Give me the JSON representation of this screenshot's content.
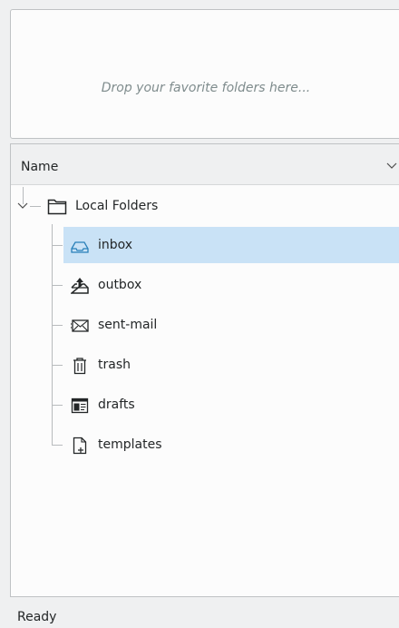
{
  "favorites": {
    "placeholder": "Drop your favorite folders here..."
  },
  "tree": {
    "header": {
      "column": "Name",
      "sort_icon": "chevron-down-icon"
    },
    "root": {
      "label": "Local Folders",
      "icon": "folder-icon",
      "expanded": true
    },
    "folders": [
      {
        "label": "inbox",
        "icon": "inbox-icon",
        "selected": true
      },
      {
        "label": "outbox",
        "icon": "outbox-icon",
        "selected": false
      },
      {
        "label": "sent-mail",
        "icon": "sent-mail-icon",
        "selected": false
      },
      {
        "label": "trash",
        "icon": "trash-icon",
        "selected": false
      },
      {
        "label": "drafts",
        "icon": "drafts-icon",
        "selected": false
      },
      {
        "label": "templates",
        "icon": "templates-icon",
        "selected": false
      }
    ]
  },
  "status": {
    "text": "Ready"
  },
  "colors": {
    "selection": "#c9e2f6",
    "background": "#eff0f1",
    "panel": "#fcfcfc"
  }
}
